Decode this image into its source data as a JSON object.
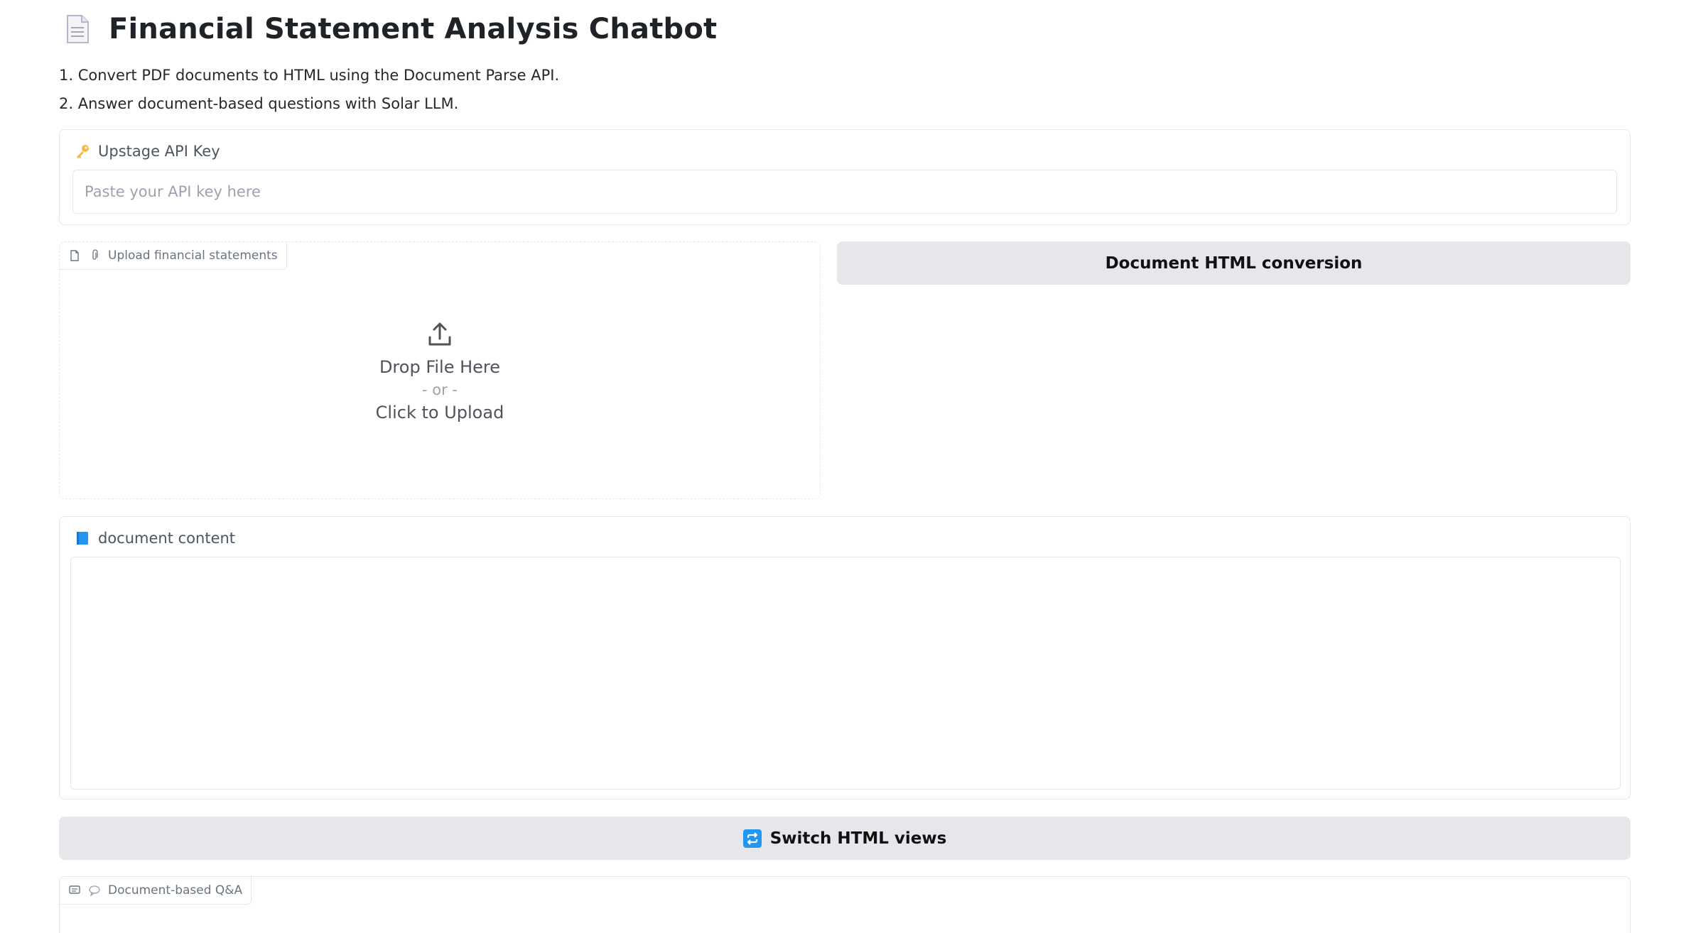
{
  "header": {
    "title": "Financial Statement Analysis Chatbot",
    "icon": "page-document-icon"
  },
  "steps": [
    "1. Convert PDF documents to HTML using the Document Parse API.",
    "2. Answer document-based questions with Solar LLM."
  ],
  "api_key": {
    "label": "Upstage API Key",
    "icon": "key-icon",
    "value": "",
    "placeholder": "Paste your API key here"
  },
  "upload": {
    "label": "Upload financial statements",
    "drop_text": "Drop File Here",
    "or_text": "- or -",
    "click_text": "Click to Upload"
  },
  "convert_button": {
    "label": "Document HTML conversion"
  },
  "document_content": {
    "label": "document content",
    "icon": "blue-book-icon"
  },
  "switch_button": {
    "label": "Switch HTML views",
    "icon": "repeat-icon"
  },
  "qa": {
    "label": "Document-based Q&A"
  },
  "colors": {
    "button_bg": "#e5e7eb",
    "border": "#e5e7eb",
    "accent_blue": "#2196f3",
    "key_gold": "#f5b942"
  }
}
